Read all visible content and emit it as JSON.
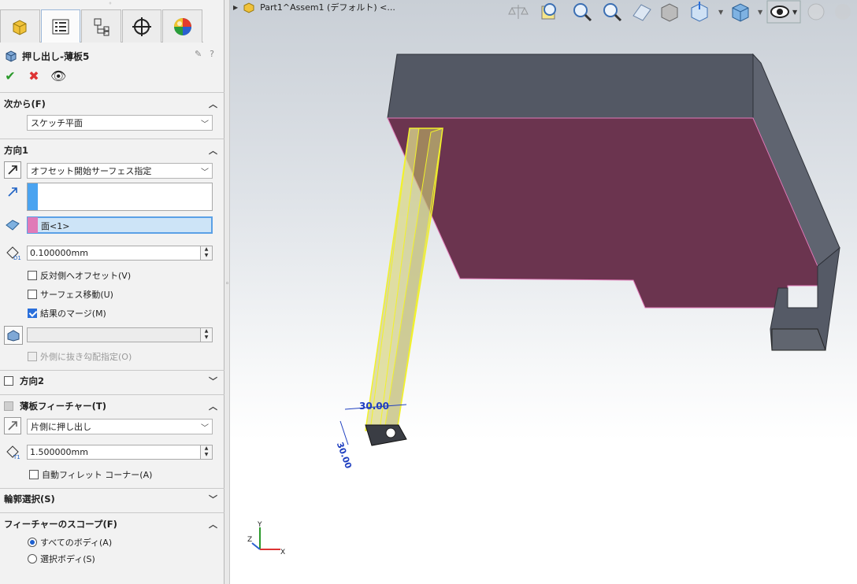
{
  "panel": {
    "feature_title": "押し出し-薄板5",
    "tabs": [
      "feature-manager",
      "property-manager",
      "configuration-manager",
      "dim-xpert",
      "display-manager"
    ],
    "from_group": {
      "label": "次から(F)",
      "value": "スケッチ平面"
    },
    "direction1": {
      "label": "方向1",
      "end_condition": "オフセット開始サーフェス指定",
      "face_value": "面<1>",
      "offset_value": "0.100000mm",
      "reverse_offset_label": "反対側へオフセット(V)",
      "translate_surface_label": "サーフェス移動(U)",
      "merge_result_label": "結果のマージ(M)",
      "draft_outward_label": "外側に抜き勾配指定(O)"
    },
    "direction2": {
      "label": "方向2"
    },
    "thin_feature": {
      "label": "薄板フィーチャー(T)",
      "type": "片側に押し出し",
      "thickness": "1.500000mm",
      "auto_fillet_label": "自動フィレット コーナー(A)"
    },
    "contour_select": {
      "label": "輪郭選択(S)"
    },
    "feature_scope": {
      "label": "フィーチャーのスコープ(F)",
      "all_bodies": "すべてのボディ(A)",
      "selected_bodies": "選択ボディ(S)"
    }
  },
  "viewport": {
    "breadcrumb": "Part1^Assem1 (デフォルト) <...",
    "dimension_h": "30.00",
    "dimension_v": "30.00",
    "triad": {
      "x": "X",
      "y": "Y",
      "z": "Z"
    }
  },
  "colors": {
    "accent": "#2a6fdb",
    "face_highlight": "#e07ab8",
    "body_dark": "#4f5460",
    "body_face": "#6b344f",
    "preview_yellow": "#f2f22a"
  }
}
